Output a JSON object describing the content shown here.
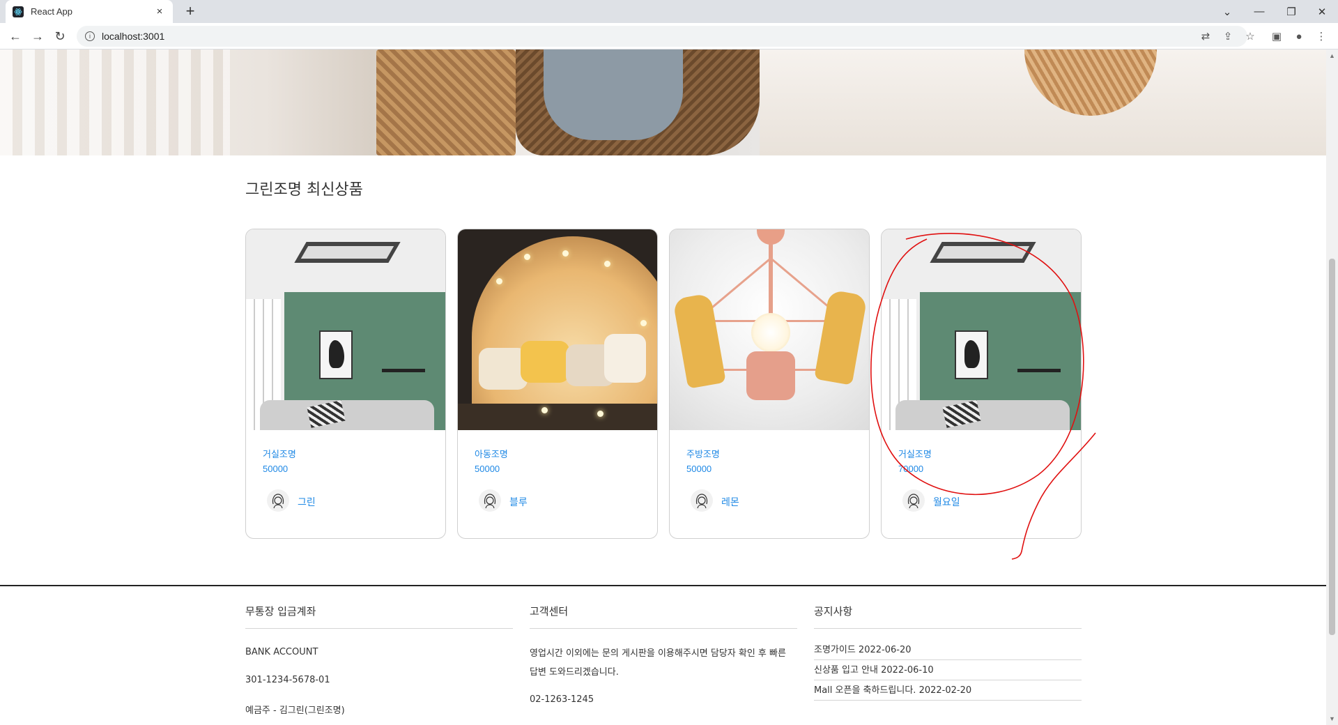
{
  "browser": {
    "tab_title": "React App",
    "tab_close": "×",
    "new_tab": "+",
    "url": "localhost:3001"
  },
  "page": {
    "section_title": "그린조명 최신상품",
    "products": [
      {
        "name": "거실조명",
        "price": "50000",
        "seller": "그린"
      },
      {
        "name": "아동조명",
        "price": "50000",
        "seller": "블루"
      },
      {
        "name": "주방조명",
        "price": "50000",
        "seller": "레몬"
      },
      {
        "name": "거실조명",
        "price": "70000",
        "seller": "월요일"
      }
    ]
  },
  "footer": {
    "bank": {
      "title": "무통장 입금계좌",
      "label": "BANK ACCOUNT",
      "account": "301-1234-5678-01",
      "holder": "예금주 - 김그린(그린조명)"
    },
    "support": {
      "title": "고객센터",
      "message": "영업시간 이외에는 문의 게시판을 이용해주시면 담당자 확인 후 빠른 답변 도와드리겠습니다.",
      "phone": "02-1263-1245"
    },
    "notices": {
      "title": "공지사항",
      "items": [
        "조명가이드 2022-06-20",
        "신상품 입고 안내 2022-06-10",
        "Mall 오픈을 축하드립니다. 2022-02-20"
      ]
    }
  },
  "icons": {
    "react": "react-atom-icon",
    "seller_avatar": "user-avatar-icon"
  },
  "colors": {
    "link": "#1e88e5",
    "annotation": "#e01010"
  }
}
